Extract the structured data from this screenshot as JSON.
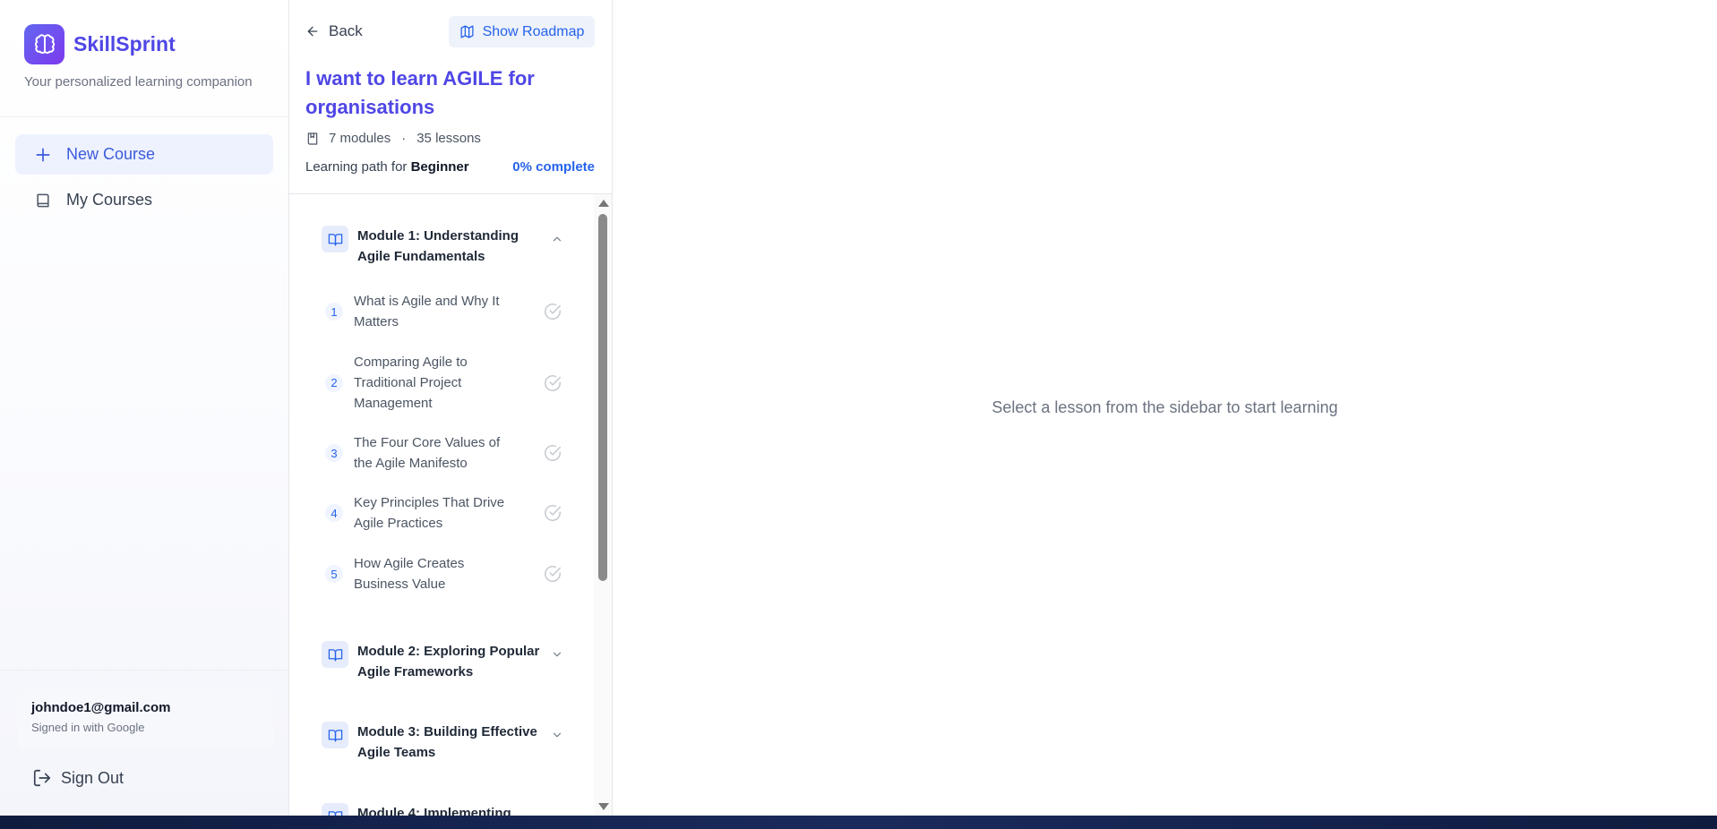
{
  "brand": {
    "name": "SkillSprint",
    "tagline": "Your personalized learning companion",
    "logo_icon": "brain-icon",
    "accent": "#4f46e5"
  },
  "nav": {
    "new_course": "New Course",
    "my_courses": "My Courses"
  },
  "user": {
    "email": "johndoe1@gmail.com",
    "signin_method": "Signed in with Google",
    "sign_out": "Sign Out"
  },
  "course": {
    "back_label": "Back",
    "roadmap_label": "Show Roadmap",
    "title": "I want to learn AGILE for organisations",
    "modules_count": "7 modules",
    "separator": "·",
    "lessons_count": "35 lessons",
    "path_prefix": "Learning path for",
    "level": "Beginner",
    "progress": "0% complete",
    "progress_value": 0
  },
  "modules": [
    {
      "title": "Module 1: Understanding Agile Fundamentals",
      "expanded": true,
      "lessons": [
        {
          "num": "1",
          "title": "What is Agile and Why It Matters"
        },
        {
          "num": "2",
          "title": "Comparing Agile to Traditional Project Management"
        },
        {
          "num": "3",
          "title": "The Four Core Values of the Agile Manifesto"
        },
        {
          "num": "4",
          "title": "Key Principles That Drive Agile Practices"
        },
        {
          "num": "5",
          "title": "How Agile Creates Business Value"
        }
      ]
    },
    {
      "title": "Module 2: Exploring Popular Agile Frameworks",
      "expanded": false
    },
    {
      "title": "Module 3: Building Effective Agile Teams",
      "expanded": false
    },
    {
      "title": "Module 4: Implementing",
      "expanded": false
    }
  ],
  "main": {
    "empty_message": "Select a lesson from the sidebar to start learning"
  }
}
